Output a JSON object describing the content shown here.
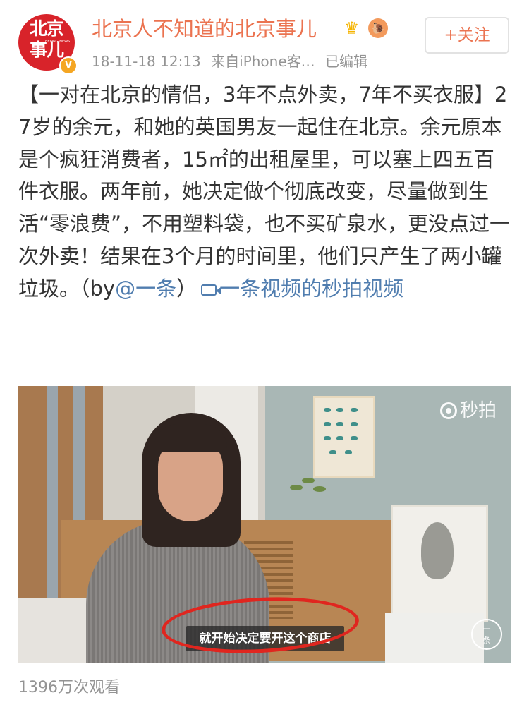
{
  "post": {
    "author": {
      "name": "北京人不知道的北京事儿",
      "avatar_text": "北京\n事儿",
      "avatar_subtext": "BEIJING NEWS",
      "verified_badge": "V",
      "membership_badge": "crown-icon",
      "fan_badge": "🐌"
    },
    "timestamp": "18-11-18 12:13",
    "source": "来自iPhone客…",
    "edited": "已编辑",
    "follow_label": "+关注",
    "text_main": "【一对在北京的情侣，3年不点外卖，7年不买衣服】27岁的余元，和她的英国男友一起住在北京。余元原本是个疯狂消费者，15㎡的出租屋里，可以塞上四五百件衣服。两年前，她决定做个彻底改变，尽量做到生活“零浪费”，不用塑料袋，也不买矿泉水，更没点过一次外卖！结果在3个月的时间里，他们只产生了两小罐垃圾。（by",
    "mention": "@一条",
    "text_mid": "）",
    "video_link": "一条视频的秒拍视频",
    "video": {
      "watermark": "秒拍",
      "subtitle": "就开始决定要开这个商店",
      "channel_logo": "一\n条"
    },
    "views": "1396万次观看"
  },
  "colors": {
    "username": "#eb7350",
    "link": "#507daf",
    "meta": "#939393",
    "annotation": "#e0261f"
  }
}
